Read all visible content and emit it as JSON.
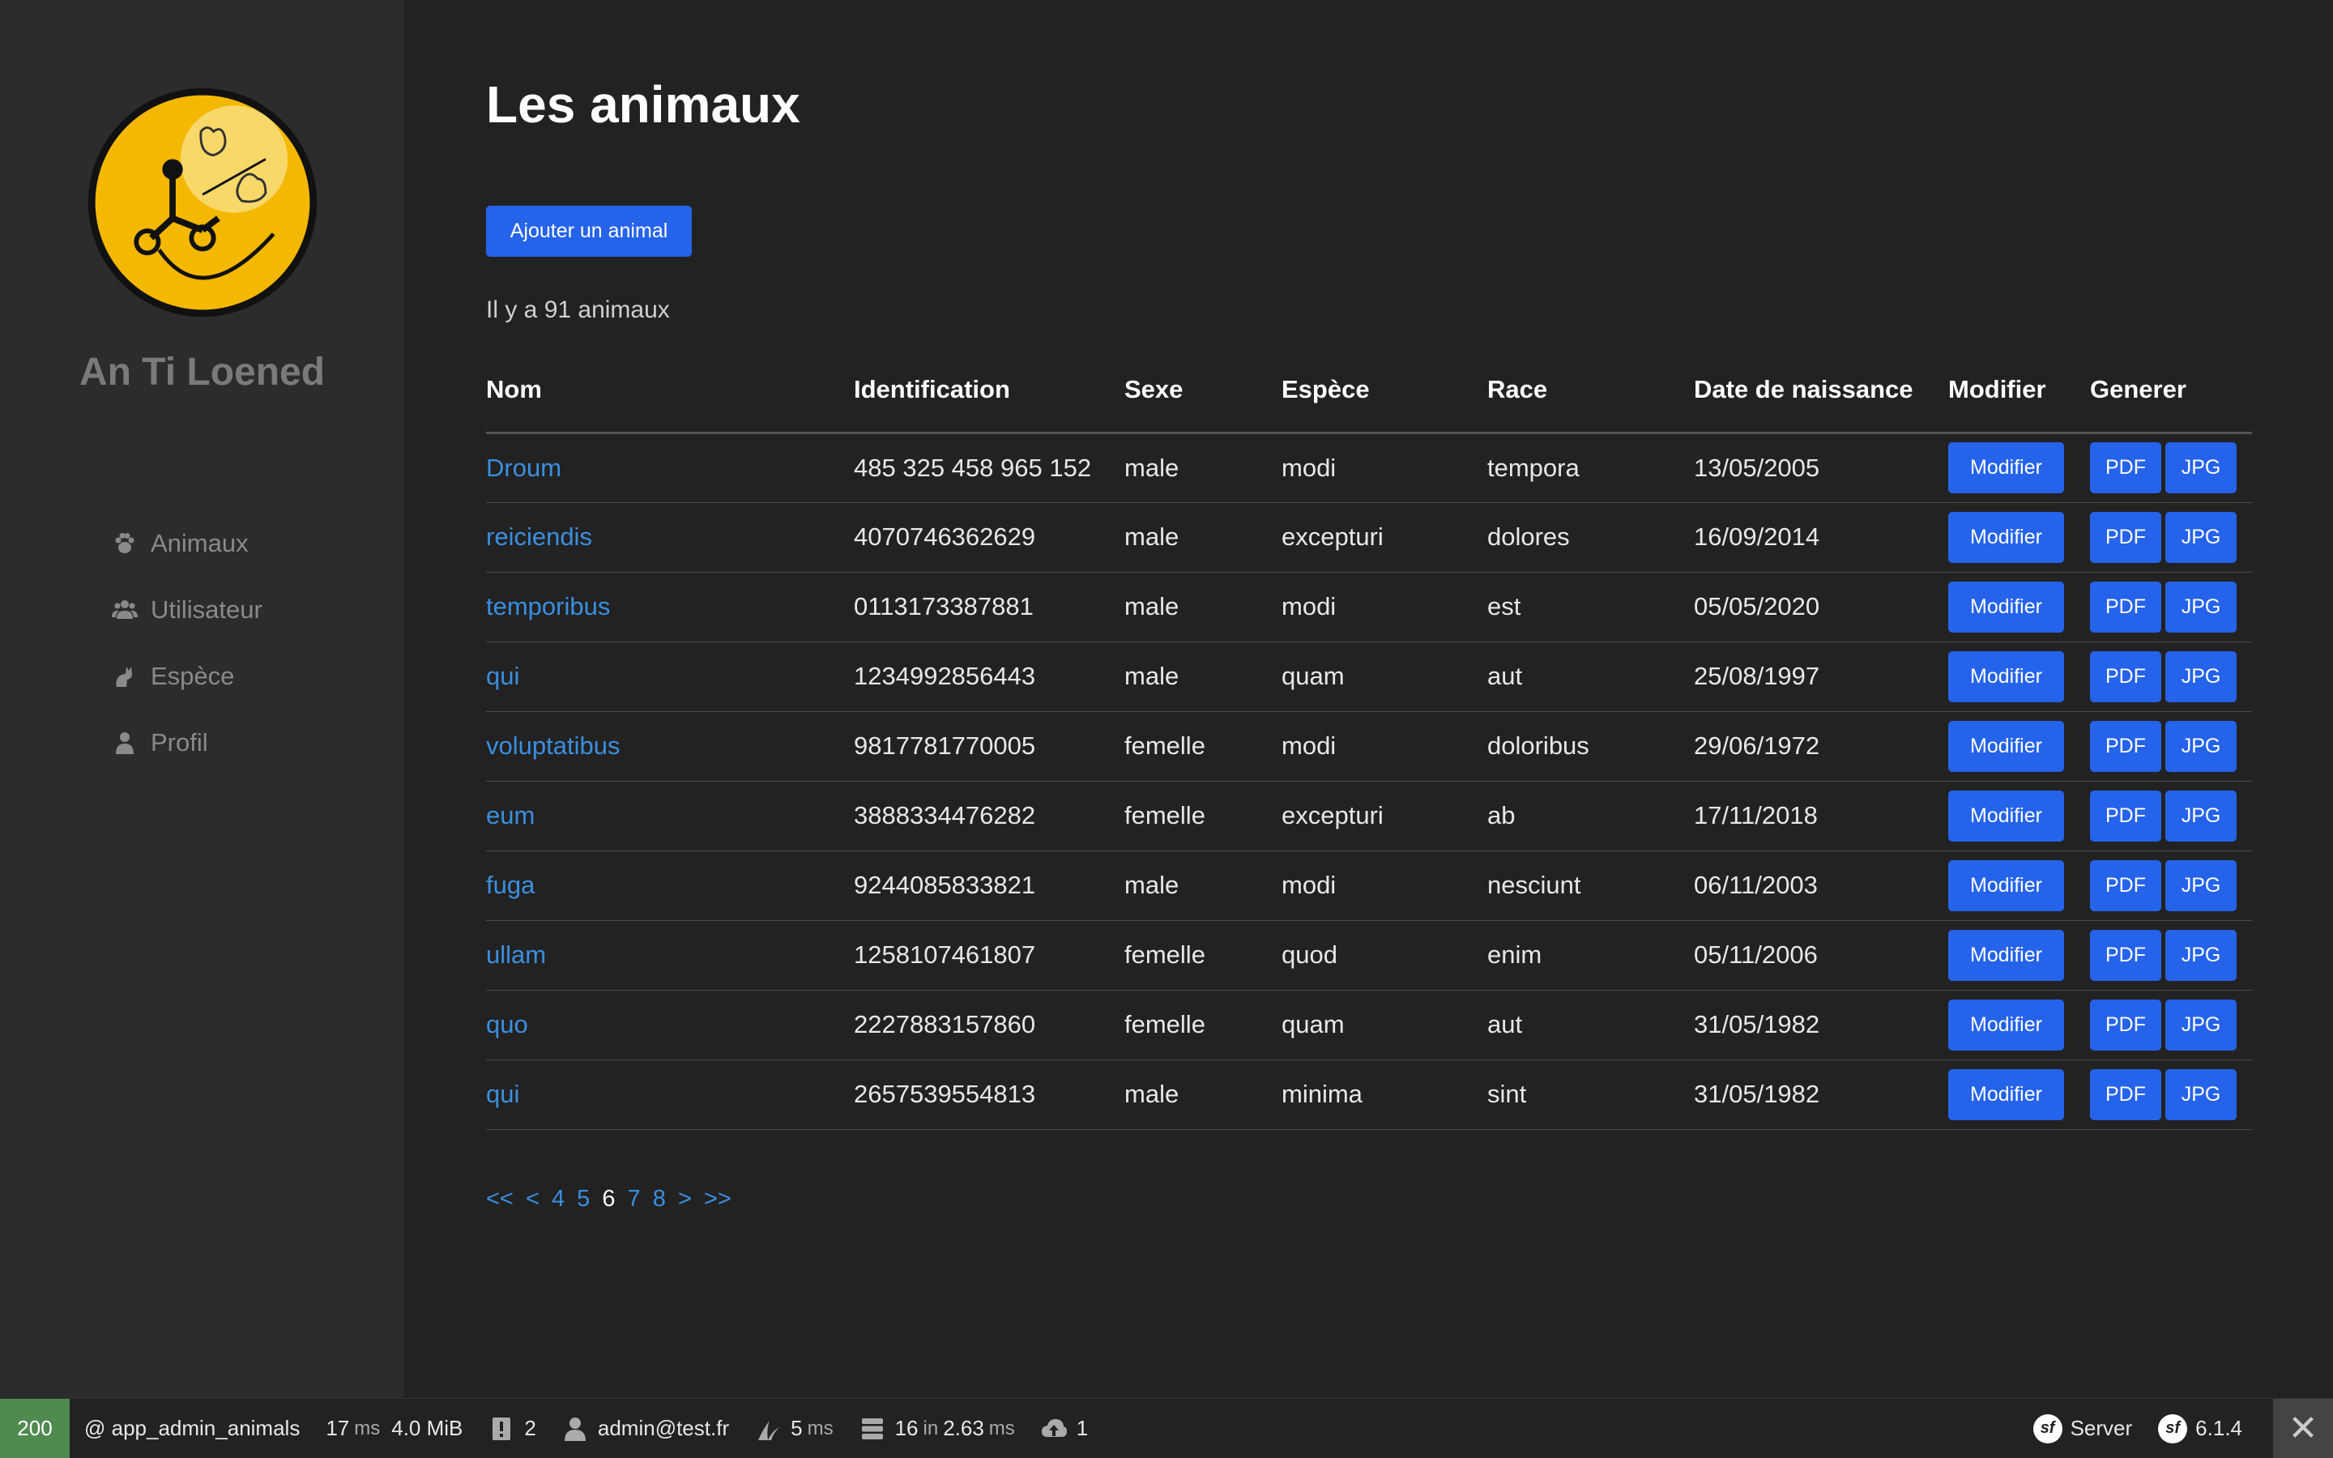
{
  "sidebar": {
    "brand": "An Ti Loened",
    "items": [
      {
        "label": "Animaux",
        "icon": "paw-icon"
      },
      {
        "label": "Utilisateur",
        "icon": "users-icon"
      },
      {
        "label": "Espèce",
        "icon": "cat-icon"
      },
      {
        "label": "Profil",
        "icon": "user-icon"
      }
    ]
  },
  "main": {
    "title": "Les animaux",
    "add_button": "Ajouter un animal",
    "count_text": "Il y a 91 animaux",
    "columns": [
      "Nom",
      "Identification",
      "Sexe",
      "Espèce",
      "Race",
      "Date de naissance",
      "Modifier",
      "Generer"
    ],
    "rows": [
      {
        "nom": "Droum",
        "identification": "485 325 458 965 152",
        "sexe": "male",
        "espece": "modi",
        "race": "tempora",
        "naissance": "13/05/2005"
      },
      {
        "nom": "reiciendis",
        "identification": "4070746362629",
        "sexe": "male",
        "espece": "excepturi",
        "race": "dolores",
        "naissance": "16/09/2014"
      },
      {
        "nom": "temporibus",
        "identification": "0113173387881",
        "sexe": "male",
        "espece": "modi",
        "race": "est",
        "naissance": "05/05/2020"
      },
      {
        "nom": "qui",
        "identification": "1234992856443",
        "sexe": "male",
        "espece": "quam",
        "race": "aut",
        "naissance": "25/08/1997"
      },
      {
        "nom": "voluptatibus",
        "identification": "9817781770005",
        "sexe": "femelle",
        "espece": "modi",
        "race": "doloribus",
        "naissance": "29/06/1972"
      },
      {
        "nom": "eum",
        "identification": "3888334476282",
        "sexe": "femelle",
        "espece": "excepturi",
        "race": "ab",
        "naissance": "17/11/2018"
      },
      {
        "nom": "fuga",
        "identification": "9244085833821",
        "sexe": "male",
        "espece": "modi",
        "race": "nesciunt",
        "naissance": "06/11/2003"
      },
      {
        "nom": "ullam",
        "identification": "1258107461807",
        "sexe": "femelle",
        "espece": "quod",
        "race": "enim",
        "naissance": "05/11/2006"
      },
      {
        "nom": "quo",
        "identification": "2227883157860",
        "sexe": "femelle",
        "espece": "quam",
        "race": "aut",
        "naissance": "31/05/1982"
      },
      {
        "nom": "qui",
        "identification": "2657539554813",
        "sexe": "male",
        "espece": "minima",
        "race": "sint",
        "naissance": "31/05/1982"
      }
    ],
    "row_buttons": {
      "modifier": "Modifier",
      "pdf": "PDF",
      "jpg": "JPG"
    },
    "pagination": {
      "first": "<<",
      "prev": "<",
      "pages": [
        "4",
        "5",
        "6",
        "7",
        "8"
      ],
      "current": "6",
      "next": ">",
      "last": ">>"
    }
  },
  "toolbar": {
    "status": "200",
    "route": "@ app_admin_animals",
    "time_value": "17",
    "time_unit": "ms",
    "memory": "4.0 MiB",
    "logs_count": "2",
    "user": "admin@test.fr",
    "twig_value": "5",
    "twig_unit": "ms",
    "db_queries": "16",
    "db_in": "in",
    "db_time": "2.63",
    "db_unit": "ms",
    "uploads": "1",
    "server_label": "Server",
    "symfony_version": "6.1.4",
    "colors": {
      "status_bg": "#4f8a4f",
      "accent": "#2563eb",
      "link": "#3b8fe0"
    }
  }
}
